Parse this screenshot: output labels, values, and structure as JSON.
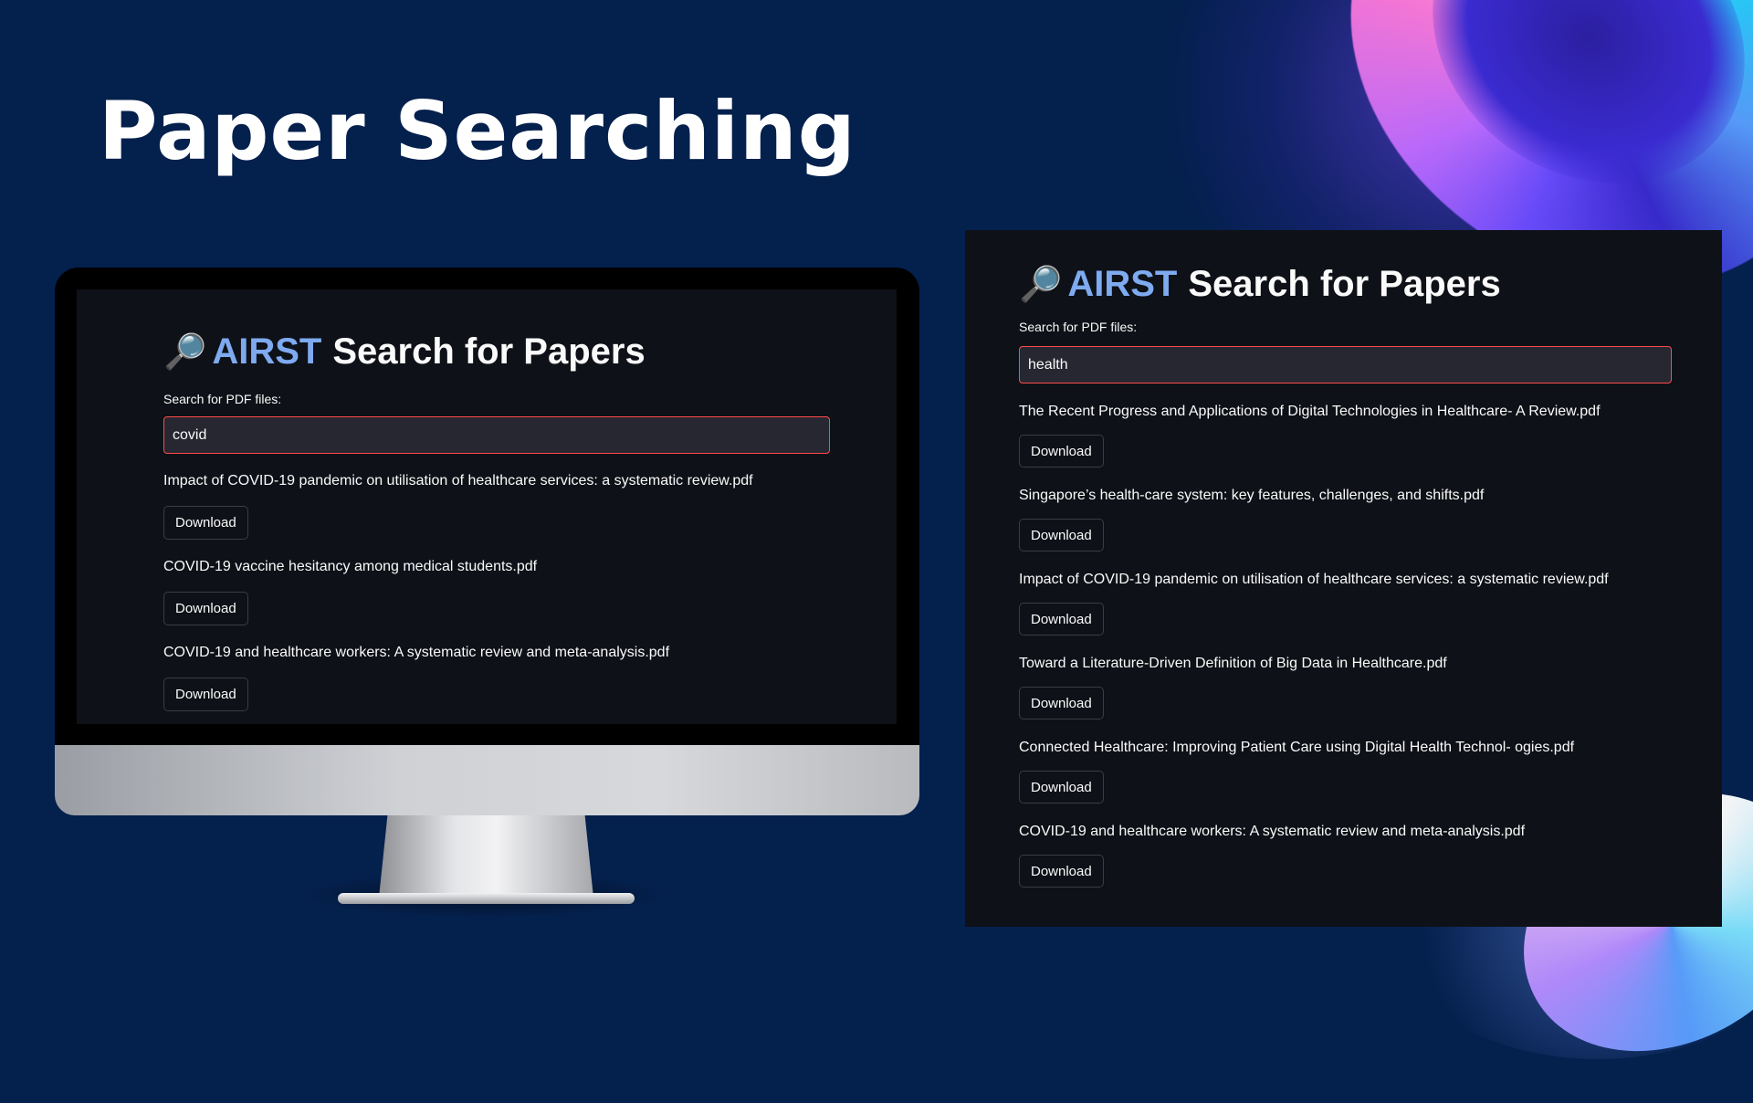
{
  "slide": {
    "title": "Paper Searching"
  },
  "colors": {
    "background": "#04204d",
    "app_background": "#0e1117",
    "brand_accent": "#7eaaf0",
    "input_border_focus": "#ff4b4b",
    "input_background": "#262730",
    "text": "#fafafa"
  },
  "left_screen": {
    "app": {
      "icon": "magnifying-glass-icon",
      "brand": "AIRST",
      "heading_rest": "Search for Papers",
      "search_label": "Search for PDF files:",
      "search_value": "covid",
      "results": [
        {
          "title": "Impact of COVID-19 pandemic on utilisation of healthcare services: a systematic review.pdf",
          "button": "Download"
        },
        {
          "title": "COVID-19 vaccine hesitancy among medical students.pdf",
          "button": "Download"
        },
        {
          "title": "COVID-19 and healthcare workers: A systematic review and meta-analysis.pdf",
          "button": "Download"
        }
      ]
    }
  },
  "right_panel": {
    "app": {
      "icon": "magnifying-glass-icon",
      "brand": "AIRST",
      "heading_rest": "Search for Papers",
      "search_label": "Search for PDF files:",
      "search_value": "health",
      "results": [
        {
          "title": "The Recent Progress and Applications of Digital Technologies in Healthcare- A Review.pdf",
          "button": "Download"
        },
        {
          "title": "Singapore’s health-care system: key features, challenges, and shifts.pdf",
          "button": "Download"
        },
        {
          "title": "Impact of COVID-19 pandemic on utilisation of healthcare services: a systematic review.pdf",
          "button": "Download"
        },
        {
          "title": "Toward a Literature-Driven Definition of Big Data in Healthcare.pdf",
          "button": "Download"
        },
        {
          "title": "Connected Healthcare: Improving Patient Care using Digital Health Technol- ogies.pdf",
          "button": "Download"
        },
        {
          "title": "COVID-19 and healthcare workers: A systematic review and meta-analysis.pdf",
          "button": "Download"
        }
      ]
    }
  }
}
